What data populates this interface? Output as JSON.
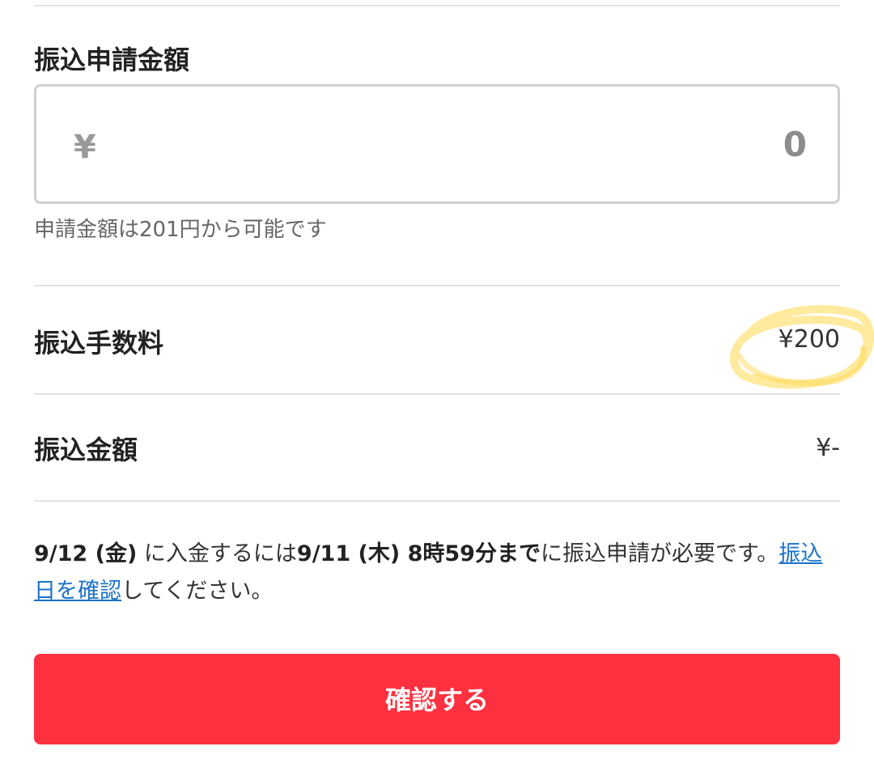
{
  "transfer_request": {
    "title": "振込申請金額",
    "currency_symbol": "¥",
    "amount_value": "0",
    "hint": "申請金額は201円から可能です"
  },
  "fee_row": {
    "label": "振込手数料",
    "value": "¥200"
  },
  "transfer_amount_row": {
    "label": "振込金額",
    "value": "¥-"
  },
  "notice": {
    "deposit_date": "9/12 (金)",
    "text_1": " に入金するには",
    "deadline": "9/11 (木) 8時59分まで",
    "text_2": "に振込申請が必要です。",
    "link_text": "振込日を確認",
    "text_3": "してください。"
  },
  "confirm_button_label": "確認する",
  "colors": {
    "button_background": "#ff303f",
    "link": "#1a73c9",
    "highlight": "#ffd84d"
  }
}
